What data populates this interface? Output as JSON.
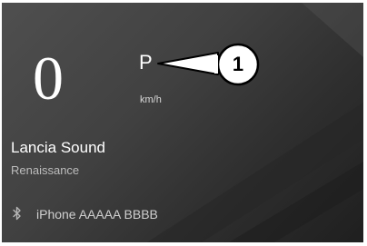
{
  "dashboard": {
    "speed": "0",
    "gear": "P",
    "speed_unit": "km/h",
    "callout_number": "1"
  },
  "media": {
    "source_title": "Lancia Sound",
    "track_subtitle": "Renaissance"
  },
  "phone": {
    "icon": "bluetooth-icon",
    "device_name": "iPhone AAAAA BBBB"
  },
  "colors": {
    "background": "#414141",
    "text_primary": "#ffffff",
    "text_secondary": "#bdbdbd",
    "callout_fill": "#ffffff",
    "callout_stroke": "#000000"
  }
}
